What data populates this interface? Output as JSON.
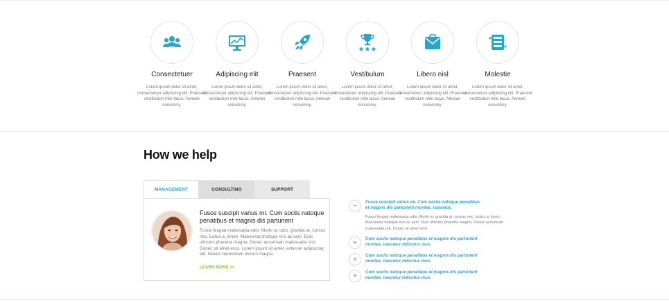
{
  "features": [
    {
      "icon": "users-group-icon",
      "title": "Consectetuer",
      "text": "Lorem ipsum dolor sit amet, consectetuer adipiscing elit. Praesent vestibulum mile lacus. Aenean nonummy."
    },
    {
      "icon": "monitor-chart-icon",
      "title": "Adipiscing elit",
      "text": "Lorem ipsum dolor sit amet, consectetuer adipiscing elit. Praesent vestibulum mile lacus. Aenean nonummy."
    },
    {
      "icon": "rocket-icon",
      "title": "Praesent",
      "text": "Lorem ipsum dolor sit amet, consectetuer adipiscing elit. Praesent vestibulum mile lacus. Aenean nonummy."
    },
    {
      "icon": "trophy-stars-icon",
      "title": "Vestibulum",
      "text": "Lorem ipsum dolor sit amet, consectetuer adipiscing elit. Praesent vestibulum mile lacus. Aenean nonummy."
    },
    {
      "icon": "envelope-icon",
      "title": "Libero nisl",
      "text": "Lorem ipsum dolor sit amet, consectetuer adipiscing elit. Praesent vestibulum mile lacus. Aenean nonummy."
    },
    {
      "icon": "server-icon",
      "title": "Molestie",
      "text": "Lorem ipsum dolor sit amet, consectetuer adipiscing elit. Praesent vestibulum mile lacus. Aenean nonummy."
    }
  ],
  "help": {
    "title": "How we help",
    "tabs": [
      {
        "label": "MANAGEMENT",
        "active": true
      },
      {
        "label": "CONSULTING",
        "active": false
      },
      {
        "label": "SUPPORT",
        "active": false
      }
    ],
    "panel": {
      "heading": "Fusce suscipit varius mi. Cum sociis natoque penatibus et magnis dis parturient",
      "text": "Fusce feugiat malesuada odio. Morbi nc odio. gravida at, cursus nec, luctus a, lorem. Maecenas tristique orci ac sem. Duis ultricies pharetra magna. Donec accumsan malesuada orci. Donec sit amet eros. Lorem ipsum sit amet, ecteruer adipiscing elit. Mauris fermentum dictum magna.",
      "link": "LEARN MORE >>"
    }
  },
  "accordion": [
    {
      "icon": "minus",
      "expanded": true,
      "title": "Fusce suscipit varius mi. Cum sociis natoque penatibus et magnis dis parturient montes, nascetur.",
      "body": "Fusce feugiat malesuada odio. Morbi nc gravida at, cursus nec, luctus a, lorem. Maecenas tristique orci ac sem. Duis ultricies pharetra magna. Donec accumsan malesuada odi. Donec sit amet eros."
    },
    {
      "icon": "+",
      "expanded": false,
      "title": "Cum sociis natoque penatibus et magnis dis parturient montes, nascetur ridiculus mus."
    },
    {
      "icon": "+",
      "expanded": false,
      "title": "Cum sociis natoque penatibus et magnis dis parturient montes, nascetur ridiculus mus."
    },
    {
      "icon": "+",
      "expanded": false,
      "title": "Cum sociis natoque penatibus et magnis dis parturient montes, nascetur ridiculus mus."
    }
  ],
  "colors": {
    "accent": "#27a5cd",
    "link": "#8bbf3a",
    "tab_inactive": "#dedede"
  }
}
